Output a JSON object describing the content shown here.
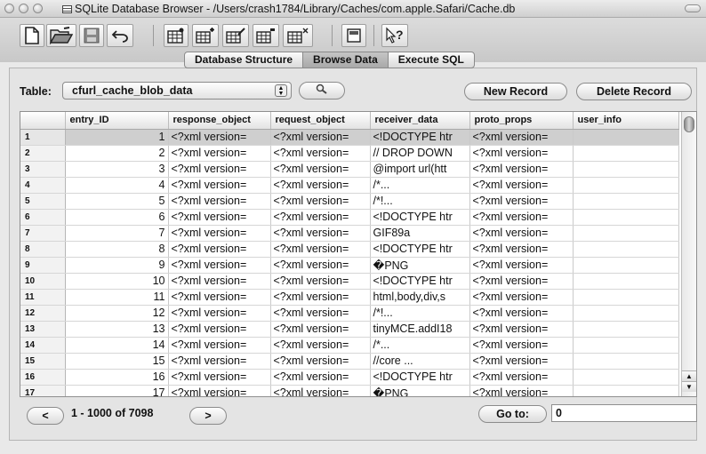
{
  "window": {
    "title": "SQLite Database Browser - /Users/crash1784/Library/Caches/com.apple.Safari/Cache.db"
  },
  "toolbar": {
    "icons": [
      "new-database-icon",
      "open-database-icon",
      "save-icon",
      "undo-icon",
      "create-table-icon",
      "create-index-icon",
      "modify-table-icon",
      "delete-table-icon",
      "delete-index-icon",
      "preferences-icon",
      "whats-this-icon"
    ]
  },
  "tabs": [
    {
      "label": "Database Structure",
      "active": false
    },
    {
      "label": "Browse Data",
      "active": true
    },
    {
      "label": "Execute SQL",
      "active": false
    }
  ],
  "browse": {
    "table_label": "Table:",
    "table_value": "cfurl_cache_blob_data",
    "new_record_label": "New Record",
    "delete_record_label": "Delete Record"
  },
  "grid": {
    "columns": [
      "",
      "entry_ID",
      "response_object",
      "request_object",
      "receiver_data",
      "proto_props",
      "user_info"
    ],
    "selected_row": 1,
    "rows": [
      {
        "num": "1",
        "entry_id": "1",
        "response_object": "<?xml version=",
        "request_object": "<?xml version=",
        "receiver_data": "<!DOCTYPE htr",
        "proto_props": "<?xml version=",
        "user_info": ""
      },
      {
        "num": "2",
        "entry_id": "2",
        "response_object": "<?xml version=",
        "request_object": "<?xml version=",
        "receiver_data": "// DROP DOWN",
        "proto_props": "<?xml version=",
        "user_info": ""
      },
      {
        "num": "3",
        "entry_id": "3",
        "response_object": "<?xml version=",
        "request_object": "<?xml version=",
        "receiver_data": "@import url(htt",
        "proto_props": "<?xml version=",
        "user_info": ""
      },
      {
        "num": "4",
        "entry_id": "4",
        "response_object": "<?xml version=",
        "request_object": "<?xml version=",
        "receiver_data": "/*...",
        "proto_props": "<?xml version=",
        "user_info": ""
      },
      {
        "num": "5",
        "entry_id": "5",
        "response_object": "<?xml version=",
        "request_object": "<?xml version=",
        "receiver_data": "/*!...",
        "proto_props": "<?xml version=",
        "user_info": ""
      },
      {
        "num": "6",
        "entry_id": "6",
        "response_object": "<?xml version=",
        "request_object": "<?xml version=",
        "receiver_data": "<!DOCTYPE htr",
        "proto_props": "<?xml version=",
        "user_info": ""
      },
      {
        "num": "7",
        "entry_id": "7",
        "response_object": "<?xml version=",
        "request_object": "<?xml version=",
        "receiver_data": "GIF89a",
        "proto_props": "<?xml version=",
        "user_info": ""
      },
      {
        "num": "8",
        "entry_id": "8",
        "response_object": "<?xml version=",
        "request_object": "<?xml version=",
        "receiver_data": "<!DOCTYPE htr",
        "proto_props": "<?xml version=",
        "user_info": ""
      },
      {
        "num": "9",
        "entry_id": "9",
        "response_object": "<?xml version=",
        "request_object": "<?xml version=",
        "receiver_data": "�PNG",
        "proto_props": "<?xml version=",
        "user_info": ""
      },
      {
        "num": "10",
        "entry_id": "10",
        "response_object": "<?xml version=",
        "request_object": "<?xml version=",
        "receiver_data": "<!DOCTYPE htr",
        "proto_props": "<?xml version=",
        "user_info": ""
      },
      {
        "num": "11",
        "entry_id": "11",
        "response_object": "<?xml version=",
        "request_object": "<?xml version=",
        "receiver_data": "html,body,div,s",
        "proto_props": "<?xml version=",
        "user_info": ""
      },
      {
        "num": "12",
        "entry_id": "12",
        "response_object": "<?xml version=",
        "request_object": "<?xml version=",
        "receiver_data": "/*!...",
        "proto_props": "<?xml version=",
        "user_info": ""
      },
      {
        "num": "13",
        "entry_id": "13",
        "response_object": "<?xml version=",
        "request_object": "<?xml version=",
        "receiver_data": "tinyMCE.addI18",
        "proto_props": "<?xml version=",
        "user_info": ""
      },
      {
        "num": "14",
        "entry_id": "14",
        "response_object": "<?xml version=",
        "request_object": "<?xml version=",
        "receiver_data": "/*...",
        "proto_props": "<?xml version=",
        "user_info": ""
      },
      {
        "num": "15",
        "entry_id": "15",
        "response_object": "<?xml version=",
        "request_object": "<?xml version=",
        "receiver_data": "//core ...",
        "proto_props": "<?xml version=",
        "user_info": ""
      },
      {
        "num": "16",
        "entry_id": "16",
        "response_object": "<?xml version=",
        "request_object": "<?xml version=",
        "receiver_data": "<!DOCTYPE htr",
        "proto_props": "<?xml version=",
        "user_info": ""
      },
      {
        "num": "17",
        "entry_id": "17",
        "response_object": "<?xml version=",
        "request_object": "<?xml version=",
        "receiver_data": "�PNG",
        "proto_props": "<?xml version=",
        "user_info": ""
      }
    ]
  },
  "footer": {
    "prev_label": "<",
    "range_text": "1 - 1000 of 7098",
    "next_label": ">",
    "goto_label": "Go to:",
    "goto_value": "0"
  }
}
